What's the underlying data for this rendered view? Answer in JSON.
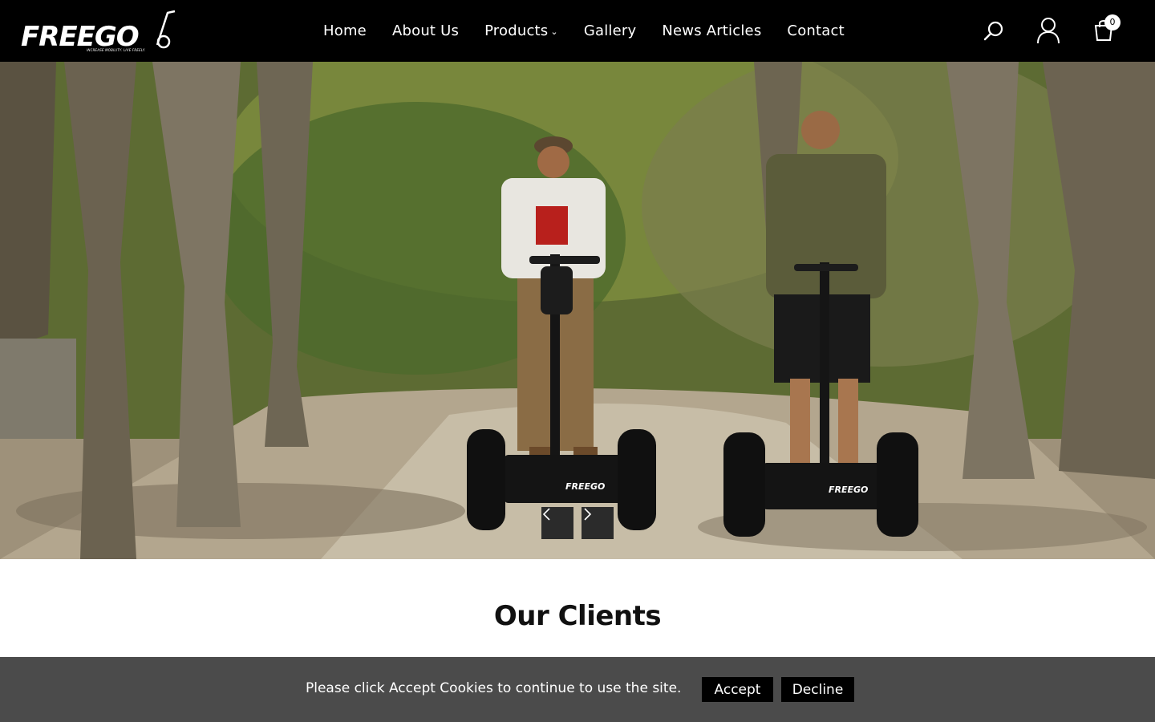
{
  "header": {
    "logo_text": "FREEGO",
    "logo_tagline": "INCREASE MOBILITY. LIVE FREELY.",
    "nav": {
      "home": "Home",
      "about": "About Us",
      "products": "Products",
      "gallery": "Gallery",
      "news": "News Articles",
      "contact": "Contact"
    },
    "icons": {
      "search": "search-icon",
      "account": "user-icon",
      "cart": "cart-icon",
      "products_caret": "chevron-down-icon"
    },
    "cart_count": "0"
  },
  "hero": {
    "product_brand_text": "FREEGO",
    "slider_prev_icon": "chevron-left-icon",
    "slider_next_icon": "chevron-right-icon"
  },
  "clients": {
    "title": "Our Clients"
  },
  "cookie_bar": {
    "message": "Please click Accept Cookies to continue to use the site.",
    "accept_label": "Accept",
    "decline_label": "Decline"
  },
  "colors": {
    "header_bg": "#000000",
    "cookie_bg": "#4b4b4b",
    "button_bg": "#000000",
    "slider_btn_bg": "#2b2b2b"
  }
}
